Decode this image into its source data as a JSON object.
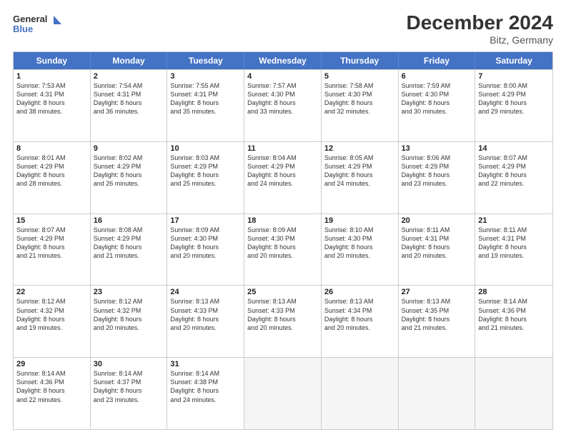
{
  "header": {
    "logo_line1": "General",
    "logo_line2": "Blue",
    "main_title": "December 2024",
    "subtitle": "Bitz, Germany"
  },
  "weekdays": [
    "Sunday",
    "Monday",
    "Tuesday",
    "Wednesday",
    "Thursday",
    "Friday",
    "Saturday"
  ],
  "rows": [
    [
      {
        "day": "1",
        "lines": [
          "Sunrise: 7:53 AM",
          "Sunset: 4:31 PM",
          "Daylight: 8 hours",
          "and 38 minutes."
        ]
      },
      {
        "day": "2",
        "lines": [
          "Sunrise: 7:54 AM",
          "Sunset: 4:31 PM",
          "Daylight: 8 hours",
          "and 36 minutes."
        ]
      },
      {
        "day": "3",
        "lines": [
          "Sunrise: 7:55 AM",
          "Sunset: 4:31 PM",
          "Daylight: 8 hours",
          "and 35 minutes."
        ]
      },
      {
        "day": "4",
        "lines": [
          "Sunrise: 7:57 AM",
          "Sunset: 4:30 PM",
          "Daylight: 8 hours",
          "and 33 minutes."
        ]
      },
      {
        "day": "5",
        "lines": [
          "Sunrise: 7:58 AM",
          "Sunset: 4:30 PM",
          "Daylight: 8 hours",
          "and 32 minutes."
        ]
      },
      {
        "day": "6",
        "lines": [
          "Sunrise: 7:59 AM",
          "Sunset: 4:30 PM",
          "Daylight: 8 hours",
          "and 30 minutes."
        ]
      },
      {
        "day": "7",
        "lines": [
          "Sunrise: 8:00 AM",
          "Sunset: 4:29 PM",
          "Daylight: 8 hours",
          "and 29 minutes."
        ]
      }
    ],
    [
      {
        "day": "8",
        "lines": [
          "Sunrise: 8:01 AM",
          "Sunset: 4:29 PM",
          "Daylight: 8 hours",
          "and 28 minutes."
        ]
      },
      {
        "day": "9",
        "lines": [
          "Sunrise: 8:02 AM",
          "Sunset: 4:29 PM",
          "Daylight: 8 hours",
          "and 26 minutes."
        ]
      },
      {
        "day": "10",
        "lines": [
          "Sunrise: 8:03 AM",
          "Sunset: 4:29 PM",
          "Daylight: 8 hours",
          "and 25 minutes."
        ]
      },
      {
        "day": "11",
        "lines": [
          "Sunrise: 8:04 AM",
          "Sunset: 4:29 PM",
          "Daylight: 8 hours",
          "and 24 minutes."
        ]
      },
      {
        "day": "12",
        "lines": [
          "Sunrise: 8:05 AM",
          "Sunset: 4:29 PM",
          "Daylight: 8 hours",
          "and 24 minutes."
        ]
      },
      {
        "day": "13",
        "lines": [
          "Sunrise: 8:06 AM",
          "Sunset: 4:29 PM",
          "Daylight: 8 hours",
          "and 23 minutes."
        ]
      },
      {
        "day": "14",
        "lines": [
          "Sunrise: 8:07 AM",
          "Sunset: 4:29 PM",
          "Daylight: 8 hours",
          "and 22 minutes."
        ]
      }
    ],
    [
      {
        "day": "15",
        "lines": [
          "Sunrise: 8:07 AM",
          "Sunset: 4:29 PM",
          "Daylight: 8 hours",
          "and 21 minutes."
        ]
      },
      {
        "day": "16",
        "lines": [
          "Sunrise: 8:08 AM",
          "Sunset: 4:29 PM",
          "Daylight: 8 hours",
          "and 21 minutes."
        ]
      },
      {
        "day": "17",
        "lines": [
          "Sunrise: 8:09 AM",
          "Sunset: 4:30 PM",
          "Daylight: 8 hours",
          "and 20 minutes."
        ]
      },
      {
        "day": "18",
        "lines": [
          "Sunrise: 8:09 AM",
          "Sunset: 4:30 PM",
          "Daylight: 8 hours",
          "and 20 minutes."
        ]
      },
      {
        "day": "19",
        "lines": [
          "Sunrise: 8:10 AM",
          "Sunset: 4:30 PM",
          "Daylight: 8 hours",
          "and 20 minutes."
        ]
      },
      {
        "day": "20",
        "lines": [
          "Sunrise: 8:11 AM",
          "Sunset: 4:31 PM",
          "Daylight: 8 hours",
          "and 20 minutes."
        ]
      },
      {
        "day": "21",
        "lines": [
          "Sunrise: 8:11 AM",
          "Sunset: 4:31 PM",
          "Daylight: 8 hours",
          "and 19 minutes."
        ]
      }
    ],
    [
      {
        "day": "22",
        "lines": [
          "Sunrise: 8:12 AM",
          "Sunset: 4:32 PM",
          "Daylight: 8 hours",
          "and 19 minutes."
        ]
      },
      {
        "day": "23",
        "lines": [
          "Sunrise: 8:12 AM",
          "Sunset: 4:32 PM",
          "Daylight: 8 hours",
          "and 20 minutes."
        ]
      },
      {
        "day": "24",
        "lines": [
          "Sunrise: 8:13 AM",
          "Sunset: 4:33 PM",
          "Daylight: 8 hours",
          "and 20 minutes."
        ]
      },
      {
        "day": "25",
        "lines": [
          "Sunrise: 8:13 AM",
          "Sunset: 4:33 PM",
          "Daylight: 8 hours",
          "and 20 minutes."
        ]
      },
      {
        "day": "26",
        "lines": [
          "Sunrise: 8:13 AM",
          "Sunset: 4:34 PM",
          "Daylight: 8 hours",
          "and 20 minutes."
        ]
      },
      {
        "day": "27",
        "lines": [
          "Sunrise: 8:13 AM",
          "Sunset: 4:35 PM",
          "Daylight: 8 hours",
          "and 21 minutes."
        ]
      },
      {
        "day": "28",
        "lines": [
          "Sunrise: 8:14 AM",
          "Sunset: 4:36 PM",
          "Daylight: 8 hours",
          "and 21 minutes."
        ]
      }
    ],
    [
      {
        "day": "29",
        "lines": [
          "Sunrise: 8:14 AM",
          "Sunset: 4:36 PM",
          "Daylight: 8 hours",
          "and 22 minutes."
        ]
      },
      {
        "day": "30",
        "lines": [
          "Sunrise: 8:14 AM",
          "Sunset: 4:37 PM",
          "Daylight: 8 hours",
          "and 23 minutes."
        ]
      },
      {
        "day": "31",
        "lines": [
          "Sunrise: 8:14 AM",
          "Sunset: 4:38 PM",
          "Daylight: 8 hours",
          "and 24 minutes."
        ]
      },
      {
        "day": "",
        "lines": []
      },
      {
        "day": "",
        "lines": []
      },
      {
        "day": "",
        "lines": []
      },
      {
        "day": "",
        "lines": []
      }
    ]
  ]
}
